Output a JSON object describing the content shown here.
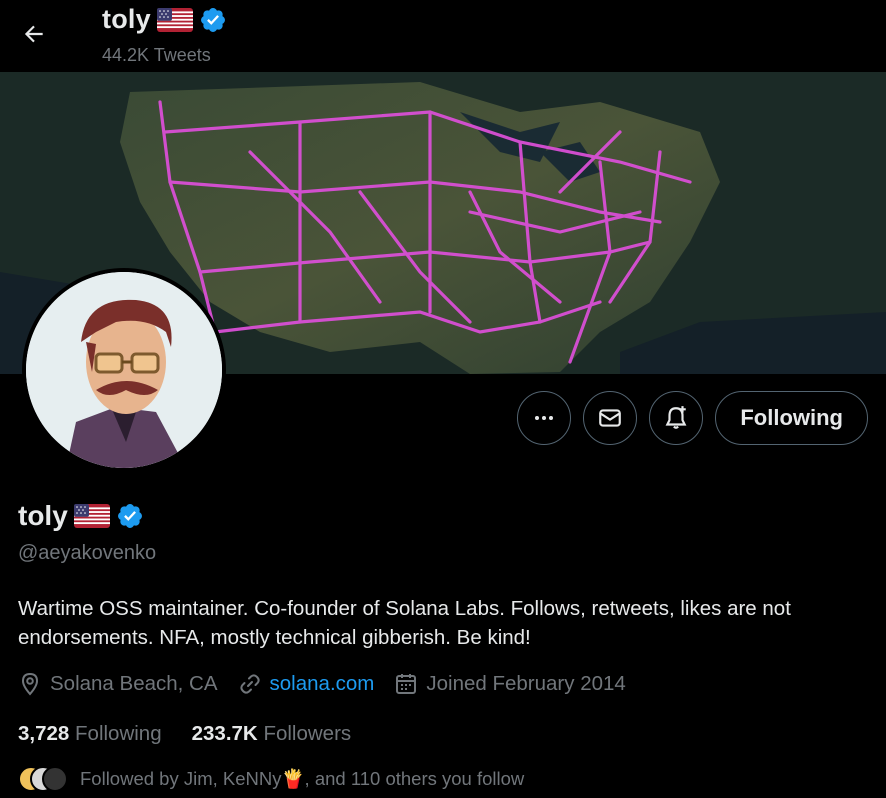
{
  "header": {
    "name": "toly",
    "tweet_count": "44.2K Tweets"
  },
  "profile": {
    "name": "toly",
    "handle": "@aeyakovenko",
    "bio": "Wartime OSS maintainer. Co-founder of Solana Labs. Follows, retweets, likes are not endorsements. NFA, mostly technical gibberish. Be kind!",
    "location": "Solana Beach, CA",
    "website": "solana.com",
    "joined": "Joined February 2014",
    "following_count": "3,728",
    "following_label": "Following",
    "followers_count": "233.7K",
    "followers_label": "Followers",
    "followed_by": "Followed by Jim, KeNNy🍟, and 110 others you follow"
  },
  "actions": {
    "following_button": "Following"
  },
  "icons": {
    "back": "arrow-left-icon",
    "flag": "us-flag-icon",
    "verified": "verified-badge-icon",
    "more": "more-dots-icon",
    "message": "mail-icon",
    "notify": "bell-plus-icon",
    "location": "location-pin-icon",
    "link": "link-icon",
    "calendar": "calendar-icon"
  },
  "colors": {
    "accent": "#1d9bf0",
    "muted": "#71767b",
    "text": "#e7e9ea",
    "banner_routes": "#d94fd6"
  }
}
